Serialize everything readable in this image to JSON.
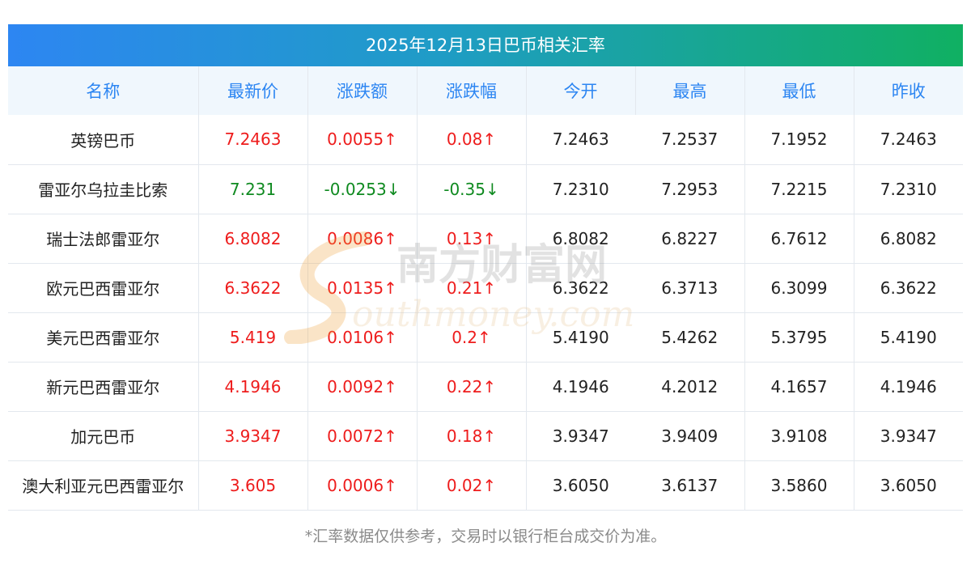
{
  "title": "2025年12月13日巴币相关汇率",
  "columns": [
    "名称",
    "最新价",
    "涨跌额",
    "涨跌幅",
    "今开",
    "最高",
    "最低",
    "昨收"
  ],
  "rows": [
    {
      "name": "英镑巴币",
      "latest": "7.2463",
      "change": "0.0055↑",
      "pct": "0.08↑",
      "open": "7.2463",
      "high": "7.2537",
      "low": "7.1952",
      "prev": "7.2463",
      "trend": "up"
    },
    {
      "name": "雷亚尔乌拉圭比索",
      "latest": "7.231",
      "change": "-0.0253↓",
      "pct": "-0.35↓",
      "open": "7.2310",
      "high": "7.2953",
      "low": "7.2215",
      "prev": "7.2310",
      "trend": "down"
    },
    {
      "name": "瑞士法郎雷亚尔",
      "latest": "6.8082",
      "change": "0.0086↑",
      "pct": "0.13↑",
      "open": "6.8082",
      "high": "6.8227",
      "low": "6.7612",
      "prev": "6.8082",
      "trend": "up"
    },
    {
      "name": "欧元巴西雷亚尔",
      "latest": "6.3622",
      "change": "0.0135↑",
      "pct": "0.21↑",
      "open": "6.3622",
      "high": "6.3713",
      "low": "6.3099",
      "prev": "6.3622",
      "trend": "up"
    },
    {
      "name": "美元巴西雷亚尔",
      "latest": "5.419",
      "change": "0.0106↑",
      "pct": "0.2↑",
      "open": "5.4190",
      "high": "5.4262",
      "low": "5.3795",
      "prev": "5.4190",
      "trend": "up"
    },
    {
      "name": "新元巴西雷亚尔",
      "latest": "4.1946",
      "change": "0.0092↑",
      "pct": "0.22↑",
      "open": "4.1946",
      "high": "4.2012",
      "low": "4.1657",
      "prev": "4.1946",
      "trend": "up"
    },
    {
      "name": "加元巴币",
      "latest": "3.9347",
      "change": "0.0072↑",
      "pct": "0.18↑",
      "open": "3.9347",
      "high": "3.9409",
      "low": "3.9108",
      "prev": "3.9347",
      "trend": "up"
    },
    {
      "name": "澳大利亚元巴西雷亚尔",
      "latest": "3.605",
      "change": "0.0006↑",
      "pct": "0.02↑",
      "open": "3.6050",
      "high": "3.6137",
      "low": "3.5860",
      "prev": "3.6050",
      "trend": "up"
    }
  ],
  "footer": "*汇率数据仅供参考，交易时以银行柜台成交价为准。",
  "watermark": {
    "cn": "南方财富网",
    "en": "outhmoney.com"
  },
  "colors": {
    "up": "#ee1c1c",
    "down": "#0f8a20",
    "header_start": "#2d86f2",
    "header_end": "#10b062",
    "column_header": "#2d86f2"
  }
}
